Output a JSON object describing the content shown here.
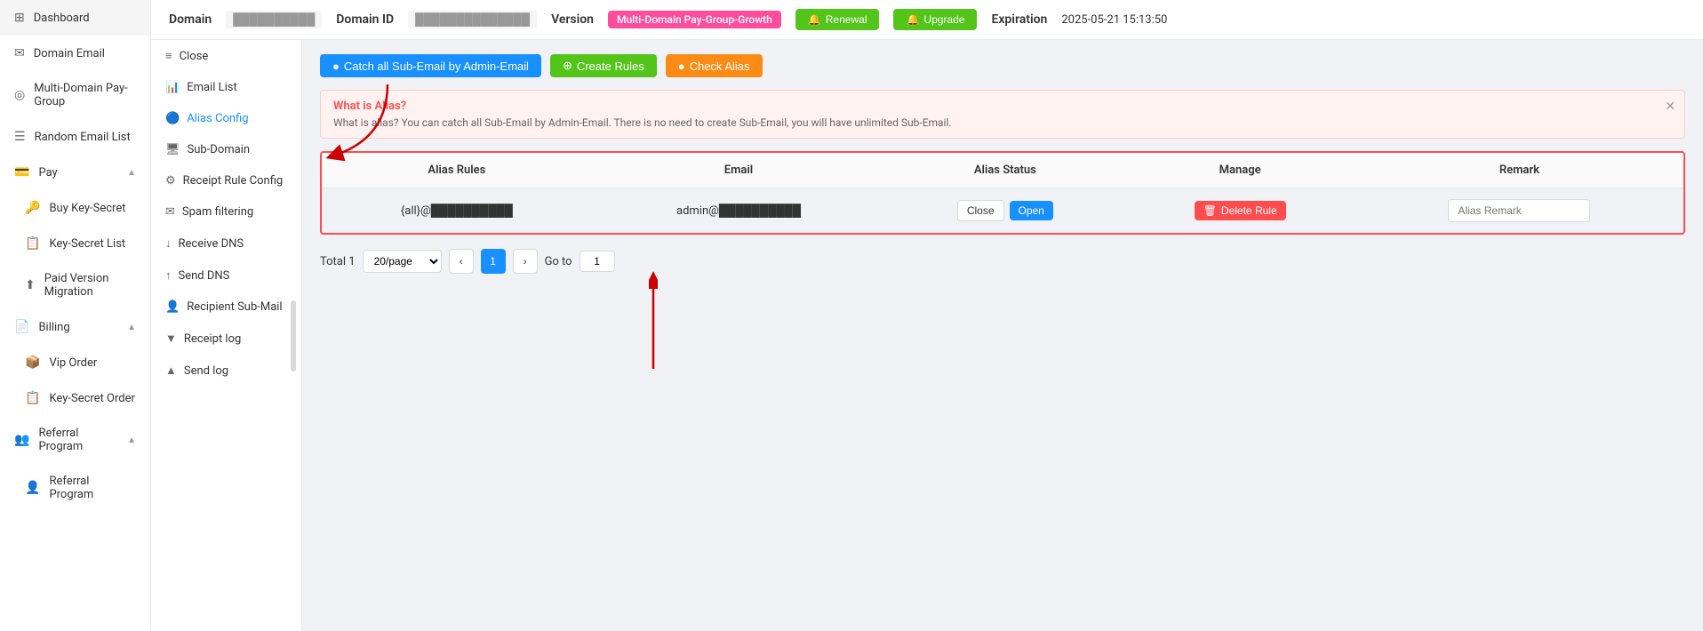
{
  "sidebar": {
    "items": [
      {
        "id": "dashboard",
        "label": "Dashboard",
        "icon": "⊞"
      },
      {
        "id": "domain-email",
        "label": "Domain Email",
        "icon": "✉"
      },
      {
        "id": "multi-domain",
        "label": "Multi-Domain Pay-Group",
        "icon": "◎"
      },
      {
        "id": "random-email",
        "label": "Random Email List",
        "icon": "☰"
      },
      {
        "id": "pay",
        "label": "Pay",
        "icon": "💳",
        "arrow": "▲"
      },
      {
        "id": "buy-key",
        "label": "Buy Key-Secret",
        "icon": "🔑"
      },
      {
        "id": "key-secret-list",
        "label": "Key-Secret List",
        "icon": "📋"
      },
      {
        "id": "paid-migration",
        "label": "Paid Version Migration",
        "icon": "⬆"
      },
      {
        "id": "billing",
        "label": "Billing",
        "icon": "📄",
        "arrow": "▲"
      },
      {
        "id": "vip-order",
        "label": "Vip Order",
        "icon": "📦"
      },
      {
        "id": "key-secret-order",
        "label": "Key-Secret Order",
        "icon": "📋"
      },
      {
        "id": "referral-program",
        "label": "Referral Program",
        "icon": "👥",
        "arrow": "▲"
      },
      {
        "id": "referral-program2",
        "label": "Referral Program",
        "icon": "👤"
      }
    ]
  },
  "header": {
    "domain_label": "Domain",
    "domain_value": "██████████",
    "domain_id_label": "Domain ID",
    "domain_id_value": "██████████████",
    "version_label": "Version",
    "version_badge": "Multi-Domain Pay-Group-Growth",
    "renewal_label": "Renewal",
    "upgrade_label": "Upgrade",
    "expiration_label": "Expiration",
    "expiration_value": "2025-05-21 15:13:50"
  },
  "sub_nav": {
    "items": [
      {
        "id": "close",
        "label": "Close",
        "icon": "≡"
      },
      {
        "id": "email-list",
        "label": "Email List",
        "icon": "📊"
      },
      {
        "id": "alias-config",
        "label": "Alias Config",
        "icon": "🔵",
        "active": true
      },
      {
        "id": "sub-domain",
        "label": "Sub-Domain",
        "icon": "🖥"
      },
      {
        "id": "receipt-rule",
        "label": "Receipt Rule Config",
        "icon": "⚙"
      },
      {
        "id": "spam-filtering",
        "label": "Spam filtering",
        "icon": "✉"
      },
      {
        "id": "receive-dns",
        "label": "Receive DNS",
        "icon": "↓"
      },
      {
        "id": "send-dns",
        "label": "Send DNS",
        "icon": "↑"
      },
      {
        "id": "recipient-sub",
        "label": "Recipient Sub-Mail",
        "icon": "👤"
      },
      {
        "id": "receipt-log",
        "label": "Receipt log",
        "icon": "▼"
      },
      {
        "id": "send-log",
        "label": "Send log",
        "icon": "▲"
      }
    ]
  },
  "action_buttons": {
    "catch_all": "Catch all Sub-Email by Admin-Email",
    "create_rules": "Create Rules",
    "check_alias": "Check Alias"
  },
  "alert": {
    "title": "What is Alias?",
    "text": "What is alias? You can catch all Sub-Email by Admin-Email. There is no need to create Sub-Email, you will have unlimited Sub-Email."
  },
  "table": {
    "columns": [
      "Alias Rules",
      "Email",
      "Alias Status",
      "Manage",
      "Remark"
    ],
    "rows": [
      {
        "alias_rules": "{all}@██████████",
        "email": "admin@██████████",
        "close_label": "Close",
        "open_label": "Open",
        "delete_label": "Delete Rule",
        "remark_placeholder": "Alias Remark"
      }
    ]
  },
  "pagination": {
    "total_label": "Total 1",
    "per_page": "20/page",
    "current_page": 1,
    "goto_label": "Go to",
    "goto_value": "1"
  }
}
